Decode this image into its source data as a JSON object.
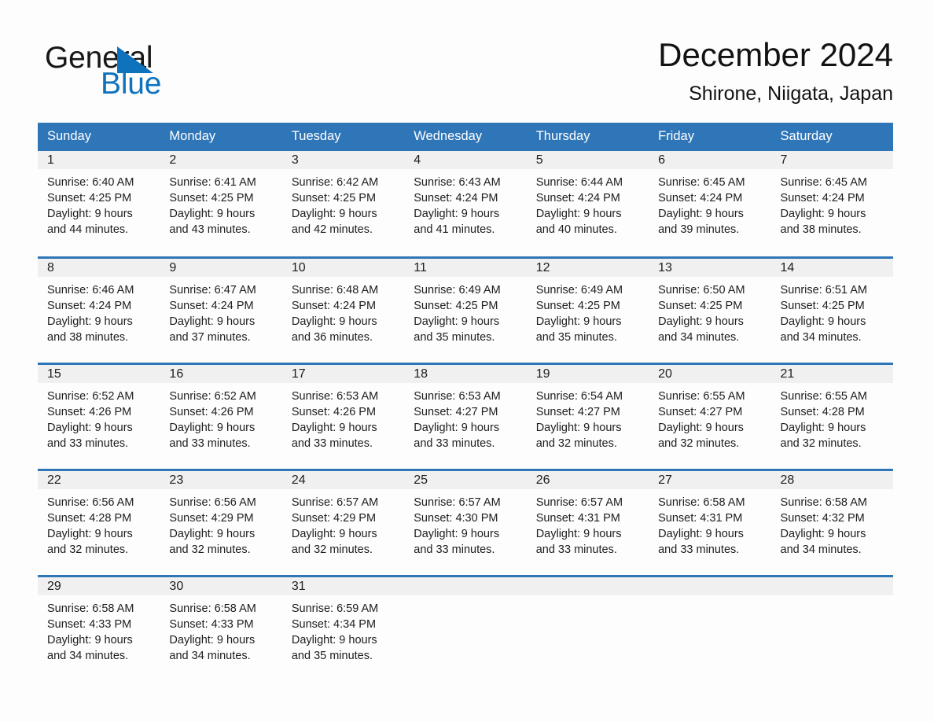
{
  "brand": {
    "line1": "General",
    "line2": "Blue",
    "logo_icon": "triangle-flag-icon",
    "accent_color": "#0f72bd"
  },
  "header": {
    "title": "December 2024",
    "location": "Shirone, Niigata, Japan"
  },
  "theme": {
    "header_blue": "#2f76b8",
    "daynum_gray": "#f0f0f0",
    "page_background": "#fdfdfd",
    "text_color": "#1d1d1d"
  },
  "calendar": {
    "weekday_headers": [
      "Sunday",
      "Monday",
      "Tuesday",
      "Wednesday",
      "Thursday",
      "Friday",
      "Saturday"
    ],
    "weeks": [
      [
        {
          "day": "1",
          "sunrise": "Sunrise: 6:40 AM",
          "sunset": "Sunset: 4:25 PM",
          "daylight_line1": "Daylight: 9 hours",
          "daylight_line2": "and 44 minutes."
        },
        {
          "day": "2",
          "sunrise": "Sunrise: 6:41 AM",
          "sunset": "Sunset: 4:25 PM",
          "daylight_line1": "Daylight: 9 hours",
          "daylight_line2": "and 43 minutes."
        },
        {
          "day": "3",
          "sunrise": "Sunrise: 6:42 AM",
          "sunset": "Sunset: 4:25 PM",
          "daylight_line1": "Daylight: 9 hours",
          "daylight_line2": "and 42 minutes."
        },
        {
          "day": "4",
          "sunrise": "Sunrise: 6:43 AM",
          "sunset": "Sunset: 4:24 PM",
          "daylight_line1": "Daylight: 9 hours",
          "daylight_line2": "and 41 minutes."
        },
        {
          "day": "5",
          "sunrise": "Sunrise: 6:44 AM",
          "sunset": "Sunset: 4:24 PM",
          "daylight_line1": "Daylight: 9 hours",
          "daylight_line2": "and 40 minutes."
        },
        {
          "day": "6",
          "sunrise": "Sunrise: 6:45 AM",
          "sunset": "Sunset: 4:24 PM",
          "daylight_line1": "Daylight: 9 hours",
          "daylight_line2": "and 39 minutes."
        },
        {
          "day": "7",
          "sunrise": "Sunrise: 6:45 AM",
          "sunset": "Sunset: 4:24 PM",
          "daylight_line1": "Daylight: 9 hours",
          "daylight_line2": "and 38 minutes."
        }
      ],
      [
        {
          "day": "8",
          "sunrise": "Sunrise: 6:46 AM",
          "sunset": "Sunset: 4:24 PM",
          "daylight_line1": "Daylight: 9 hours",
          "daylight_line2": "and 38 minutes."
        },
        {
          "day": "9",
          "sunrise": "Sunrise: 6:47 AM",
          "sunset": "Sunset: 4:24 PM",
          "daylight_line1": "Daylight: 9 hours",
          "daylight_line2": "and 37 minutes."
        },
        {
          "day": "10",
          "sunrise": "Sunrise: 6:48 AM",
          "sunset": "Sunset: 4:24 PM",
          "daylight_line1": "Daylight: 9 hours",
          "daylight_line2": "and 36 minutes."
        },
        {
          "day": "11",
          "sunrise": "Sunrise: 6:49 AM",
          "sunset": "Sunset: 4:25 PM",
          "daylight_line1": "Daylight: 9 hours",
          "daylight_line2": "and 35 minutes."
        },
        {
          "day": "12",
          "sunrise": "Sunrise: 6:49 AM",
          "sunset": "Sunset: 4:25 PM",
          "daylight_line1": "Daylight: 9 hours",
          "daylight_line2": "and 35 minutes."
        },
        {
          "day": "13",
          "sunrise": "Sunrise: 6:50 AM",
          "sunset": "Sunset: 4:25 PM",
          "daylight_line1": "Daylight: 9 hours",
          "daylight_line2": "and 34 minutes."
        },
        {
          "day": "14",
          "sunrise": "Sunrise: 6:51 AM",
          "sunset": "Sunset: 4:25 PM",
          "daylight_line1": "Daylight: 9 hours",
          "daylight_line2": "and 34 minutes."
        }
      ],
      [
        {
          "day": "15",
          "sunrise": "Sunrise: 6:52 AM",
          "sunset": "Sunset: 4:26 PM",
          "daylight_line1": "Daylight: 9 hours",
          "daylight_line2": "and 33 minutes."
        },
        {
          "day": "16",
          "sunrise": "Sunrise: 6:52 AM",
          "sunset": "Sunset: 4:26 PM",
          "daylight_line1": "Daylight: 9 hours",
          "daylight_line2": "and 33 minutes."
        },
        {
          "day": "17",
          "sunrise": "Sunrise: 6:53 AM",
          "sunset": "Sunset: 4:26 PM",
          "daylight_line1": "Daylight: 9 hours",
          "daylight_line2": "and 33 minutes."
        },
        {
          "day": "18",
          "sunrise": "Sunrise: 6:53 AM",
          "sunset": "Sunset: 4:27 PM",
          "daylight_line1": "Daylight: 9 hours",
          "daylight_line2": "and 33 minutes."
        },
        {
          "day": "19",
          "sunrise": "Sunrise: 6:54 AM",
          "sunset": "Sunset: 4:27 PM",
          "daylight_line1": "Daylight: 9 hours",
          "daylight_line2": "and 32 minutes."
        },
        {
          "day": "20",
          "sunrise": "Sunrise: 6:55 AM",
          "sunset": "Sunset: 4:27 PM",
          "daylight_line1": "Daylight: 9 hours",
          "daylight_line2": "and 32 minutes."
        },
        {
          "day": "21",
          "sunrise": "Sunrise: 6:55 AM",
          "sunset": "Sunset: 4:28 PM",
          "daylight_line1": "Daylight: 9 hours",
          "daylight_line2": "and 32 minutes."
        }
      ],
      [
        {
          "day": "22",
          "sunrise": "Sunrise: 6:56 AM",
          "sunset": "Sunset: 4:28 PM",
          "daylight_line1": "Daylight: 9 hours",
          "daylight_line2": "and 32 minutes."
        },
        {
          "day": "23",
          "sunrise": "Sunrise: 6:56 AM",
          "sunset": "Sunset: 4:29 PM",
          "daylight_line1": "Daylight: 9 hours",
          "daylight_line2": "and 32 minutes."
        },
        {
          "day": "24",
          "sunrise": "Sunrise: 6:57 AM",
          "sunset": "Sunset: 4:29 PM",
          "daylight_line1": "Daylight: 9 hours",
          "daylight_line2": "and 32 minutes."
        },
        {
          "day": "25",
          "sunrise": "Sunrise: 6:57 AM",
          "sunset": "Sunset: 4:30 PM",
          "daylight_line1": "Daylight: 9 hours",
          "daylight_line2": "and 33 minutes."
        },
        {
          "day": "26",
          "sunrise": "Sunrise: 6:57 AM",
          "sunset": "Sunset: 4:31 PM",
          "daylight_line1": "Daylight: 9 hours",
          "daylight_line2": "and 33 minutes."
        },
        {
          "day": "27",
          "sunrise": "Sunrise: 6:58 AM",
          "sunset": "Sunset: 4:31 PM",
          "daylight_line1": "Daylight: 9 hours",
          "daylight_line2": "and 33 minutes."
        },
        {
          "day": "28",
          "sunrise": "Sunrise: 6:58 AM",
          "sunset": "Sunset: 4:32 PM",
          "daylight_line1": "Daylight: 9 hours",
          "daylight_line2": "and 34 minutes."
        }
      ],
      [
        {
          "day": "29",
          "sunrise": "Sunrise: 6:58 AM",
          "sunset": "Sunset: 4:33 PM",
          "daylight_line1": "Daylight: 9 hours",
          "daylight_line2": "and 34 minutes."
        },
        {
          "day": "30",
          "sunrise": "Sunrise: 6:58 AM",
          "sunset": "Sunset: 4:33 PM",
          "daylight_line1": "Daylight: 9 hours",
          "daylight_line2": "and 34 minutes."
        },
        {
          "day": "31",
          "sunrise": "Sunrise: 6:59 AM",
          "sunset": "Sunset: 4:34 PM",
          "daylight_line1": "Daylight: 9 hours",
          "daylight_line2": "and 35 minutes."
        },
        {
          "day": "",
          "sunrise": "",
          "sunset": "",
          "daylight_line1": "",
          "daylight_line2": ""
        },
        {
          "day": "",
          "sunrise": "",
          "sunset": "",
          "daylight_line1": "",
          "daylight_line2": ""
        },
        {
          "day": "",
          "sunrise": "",
          "sunset": "",
          "daylight_line1": "",
          "daylight_line2": ""
        },
        {
          "day": "",
          "sunrise": "",
          "sunset": "",
          "daylight_line1": "",
          "daylight_line2": ""
        }
      ]
    ]
  }
}
